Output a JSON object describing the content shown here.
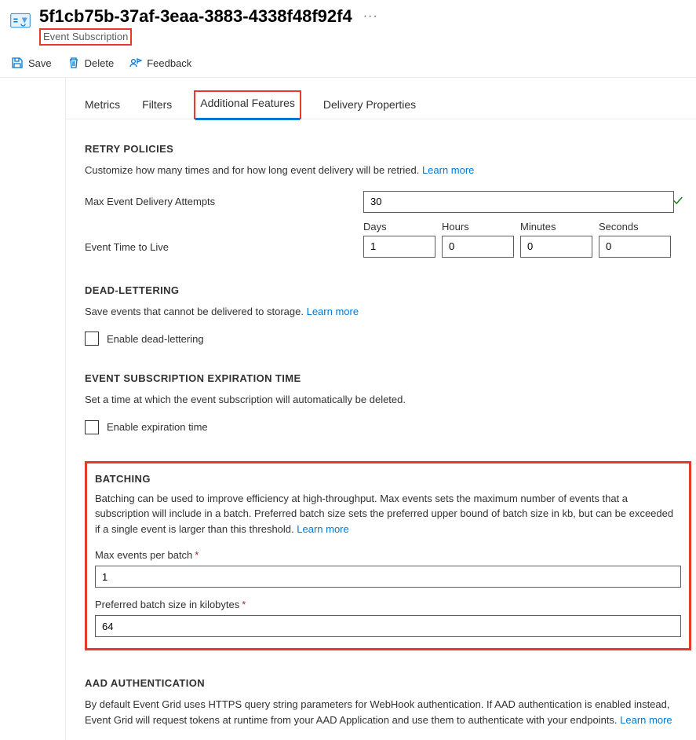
{
  "header": {
    "title": "5f1cb75b-37af-3eaa-3883-4338f48f92f4",
    "subtitle": "Event Subscription"
  },
  "toolbar": {
    "save": "Save",
    "delete": "Delete",
    "feedback": "Feedback"
  },
  "tabs": {
    "metrics": "Metrics",
    "filters": "Filters",
    "additional": "Additional Features",
    "delivery": "Delivery Properties"
  },
  "retry": {
    "title": "RETRY POLICIES",
    "desc": "Customize how many times and for how long event delivery will be retried.",
    "learn": "Learn more",
    "max_label": "Max Event Delivery Attempts",
    "max_value": "30",
    "ttl_label": "Event Time to Live",
    "ttl_caps": {
      "days": "Days",
      "hours": "Hours",
      "minutes": "Minutes",
      "seconds": "Seconds"
    },
    "ttl_vals": {
      "days": "1",
      "hours": "0",
      "minutes": "0",
      "seconds": "0"
    }
  },
  "dead": {
    "title": "DEAD-LETTERING",
    "desc": "Save events that cannot be delivered to storage.",
    "learn": "Learn more",
    "enable": "Enable dead-lettering"
  },
  "expire": {
    "title": "EVENT SUBSCRIPTION EXPIRATION TIME",
    "desc": "Set a time at which the event subscription will automatically be deleted.",
    "enable": "Enable expiration time"
  },
  "batch": {
    "title": "BATCHING",
    "desc": "Batching can be used to improve efficiency at high-throughput. Max events sets the maximum number of events that a subscription will include in a batch. Preferred batch size sets the preferred upper bound of batch size in kb, but can be exceeded if a single event is larger than this threshold.",
    "learn": "Learn more",
    "max_events_label": "Max events per batch",
    "max_events_value": "1",
    "pref_size_label": "Preferred batch size in kilobytes",
    "pref_size_value": "64"
  },
  "aad": {
    "title": "AAD AUTHENTICATION",
    "desc": "By default Event Grid uses HTTPS query string parameters for WebHook authentication. If AAD authentication is enabled instead, Event Grid will request tokens at runtime from your AAD Application and use them to authenticate with your endpoints.",
    "learn": "Learn more"
  }
}
